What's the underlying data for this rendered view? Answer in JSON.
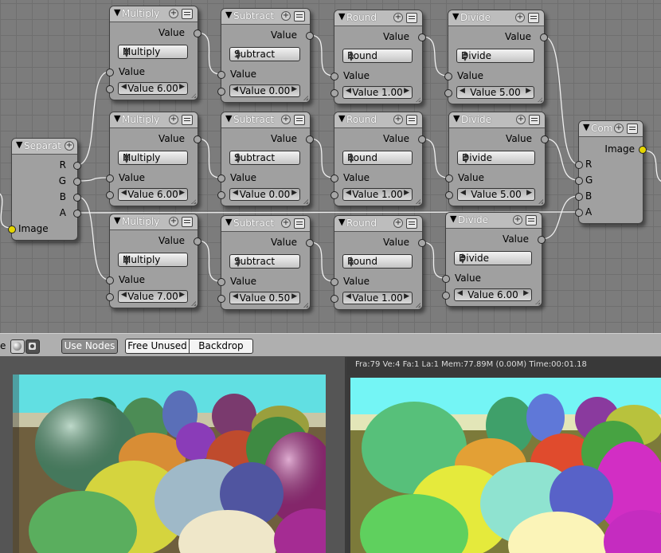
{
  "nodes": {
    "separate": {
      "title": "Separat",
      "outputs": [
        "R",
        "G",
        "B",
        "A"
      ],
      "input": "Image"
    },
    "combine": {
      "title": "Com",
      "output": "Image",
      "inputs": [
        "R",
        "G",
        "B",
        "A"
      ]
    },
    "rows": [
      [
        {
          "title": "Multiply",
          "out": "Value",
          "select": "Multiply",
          "in": "Value",
          "value": "Value 6.00"
        },
        {
          "title": "Subtract",
          "out": "Value",
          "select": "Subtract",
          "in": "Value",
          "value": "Value 0.00"
        },
        {
          "title": "Round",
          "out": "Value",
          "select": "Round",
          "in": "Value",
          "value": "Value 1.00"
        },
        {
          "title": "Divide",
          "out": "Value",
          "select": "Divide",
          "in": "Value",
          "value": "Value 5.00"
        }
      ],
      [
        {
          "title": "Multiply",
          "out": "Value",
          "select": "Multiply",
          "in": "Value",
          "value": "Value 6.00"
        },
        {
          "title": "Subtract",
          "out": "Value",
          "select": "Subtract",
          "in": "Value",
          "value": "Value 0.00"
        },
        {
          "title": "Round",
          "out": "Value",
          "select": "Round",
          "in": "Value",
          "value": "Value 1.00"
        },
        {
          "title": "Divide",
          "out": "Value",
          "select": "Divide",
          "in": "Value",
          "value": "Value 5.00"
        }
      ],
      [
        {
          "title": "Multiply",
          "out": "Value",
          "select": "Multiply",
          "in": "Value",
          "value": "Value 7.00"
        },
        {
          "title": "Subtract",
          "out": "Value",
          "select": "Subtract",
          "in": "Value",
          "value": "Value 0.50"
        },
        {
          "title": "Round",
          "out": "Value",
          "select": "Round",
          "in": "Value",
          "value": "Value 1.00"
        },
        {
          "title": "Divide",
          "out": "Value",
          "select": "Divide",
          "in": "Value",
          "value": "Value 6.00"
        }
      ]
    ]
  },
  "header": {
    "edge_char": "e",
    "use_nodes": "Use Nodes",
    "free_unused": "Free Unused",
    "backdrop": "Backdrop"
  },
  "render_info": "Fra:79  Ve:4 Fa:1 La:1 Mem:77.89M (0.00M) Time:00:01.18",
  "icons": {
    "node_menu": "node-menu-icon",
    "add": "plus-icon",
    "collapse": "triangle-down-icon",
    "resize": "resize-grip-icon"
  }
}
